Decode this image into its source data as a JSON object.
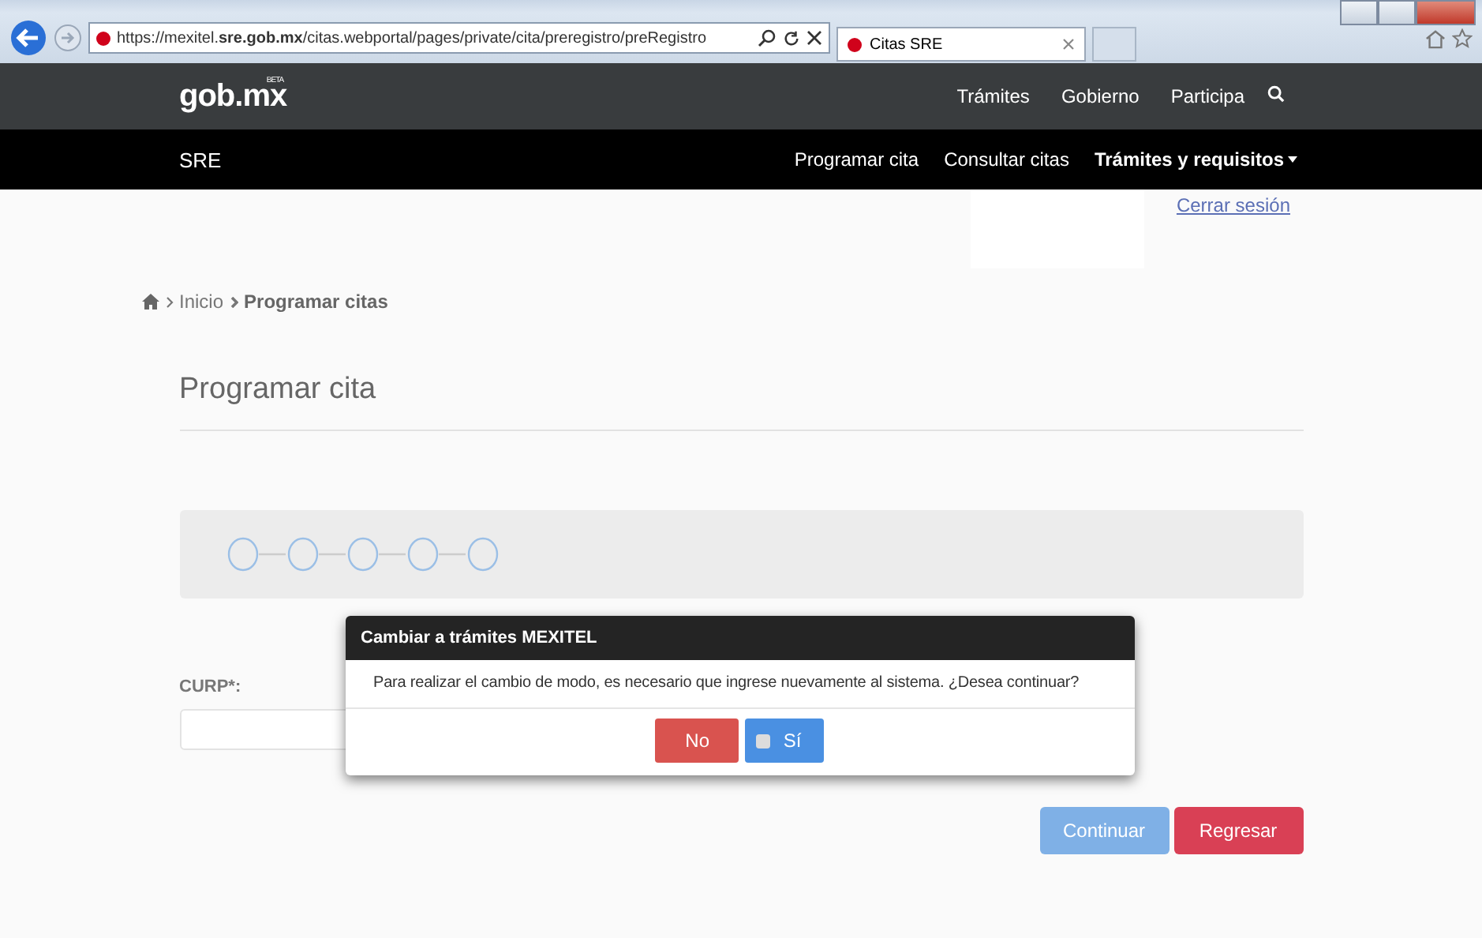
{
  "browser": {
    "url": "https://mexitel.**sre.gob.mx**/citas.webportal/pages/private/cita/preregistro/preRegistro",
    "tab_title": "Citas SRE"
  },
  "gov_bar": {
    "logo": "gob.mx",
    "logo_badge": "BETA",
    "links": [
      "Trámites",
      "Gobierno",
      "Participa"
    ]
  },
  "site_bar": {
    "title": "SRE",
    "links": [
      {
        "label": "Programar cita",
        "bold": false
      },
      {
        "label": "Consultar citas",
        "bold": false
      },
      {
        "label": "Trámites y requisitos",
        "bold": true
      }
    ]
  },
  "logout_link": "Cerrar sesión",
  "breadcrumb": [
    {
      "label": "Inicio",
      "current": false
    },
    {
      "label": "Programar citas",
      "current": true
    }
  ],
  "page_title": "Programar cita",
  "form": {
    "label": "CURP*:"
  },
  "buttons": [
    {
      "label": "Continuar",
      "kind": "primary",
      "disabled": true
    },
    {
      "label": "Regresar",
      "kind": "danger",
      "disabled": false
    }
  ],
  "dialog": {
    "title": "Cambiar a trámites MEXITEL",
    "message": "Para realizar el cambio de modo, es necesario que ingrese nuevamente al sistema. ¿Desea continuar?",
    "buttons": [
      {
        "label": "No",
        "kind": "danger"
      },
      {
        "label": "Sí",
        "kind": "primary"
      }
    ]
  }
}
